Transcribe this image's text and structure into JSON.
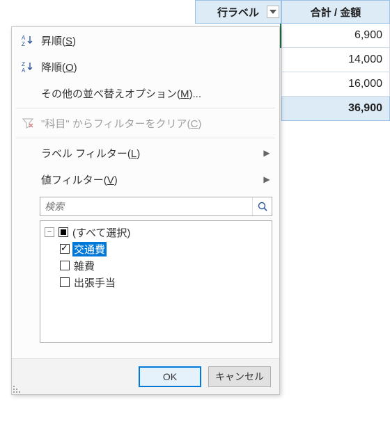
{
  "header": {
    "row_label": "行ラベル",
    "amount_label": "合計 / 金額"
  },
  "data_values": [
    "6,900",
    "14,000",
    "16,000",
    "36,900"
  ],
  "menu": {
    "sort_asc": "昇順(<u>S</u>)",
    "sort_desc": "降順(<u>O</u>)",
    "more_sort": "その他の並べ替えオプション(<u>M</u>)...",
    "clear_filter": "\"科目\" からフィルターをクリア(<u>C</u>)",
    "label_filter": "ラベル フィルター(<u>L</u>)",
    "value_filter": "値フィルター(<u>V</u>)"
  },
  "search": {
    "placeholder": "検索"
  },
  "tree": {
    "select_all": "(すべて選択)",
    "items": [
      {
        "label": "交通費",
        "checked": true,
        "selected": true
      },
      {
        "label": "雑費",
        "checked": false,
        "selected": false
      },
      {
        "label": "出張手当",
        "checked": false,
        "selected": false
      }
    ]
  },
  "buttons": {
    "ok": "OK",
    "cancel": "キャンセル"
  }
}
